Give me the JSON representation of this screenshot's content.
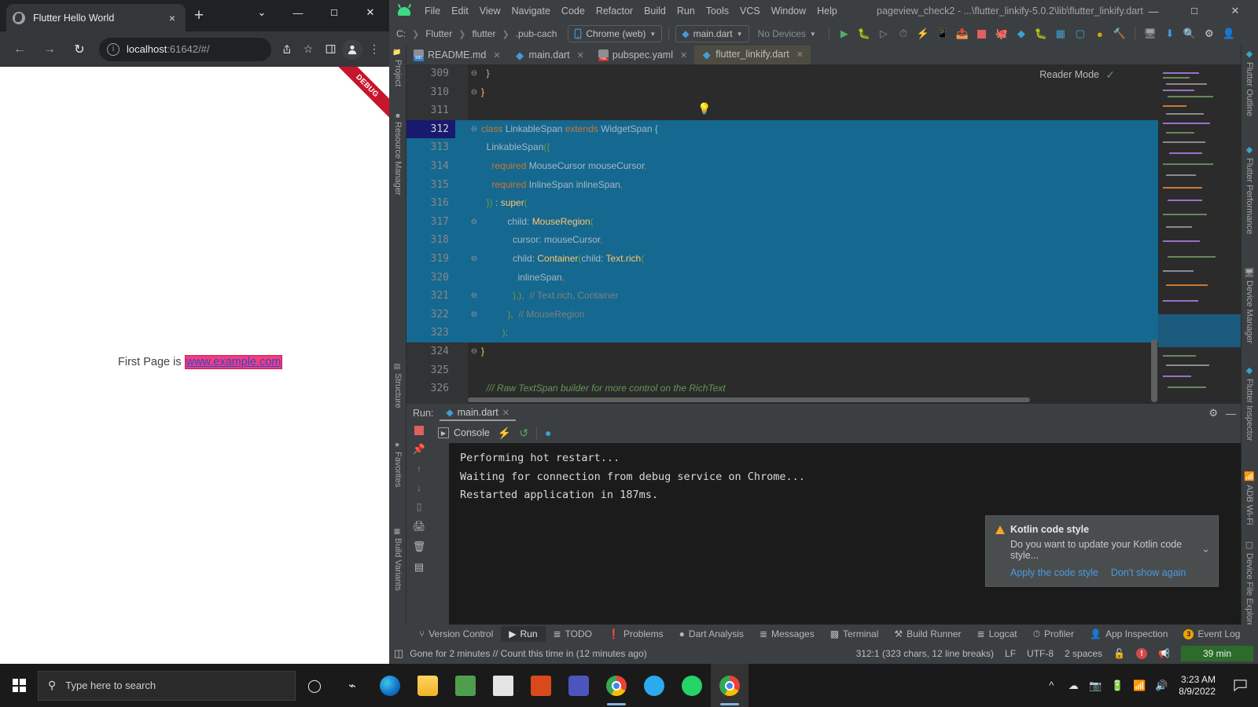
{
  "browser": {
    "tab": {
      "title": "Flutter Hello World",
      "favicon": "globe-icon",
      "close": "×"
    },
    "new_tab": "+",
    "window_controls": {
      "chevron": "⌄",
      "minimize": "—",
      "maximize": "☐",
      "close": "✕"
    },
    "nav": {
      "back": "←",
      "forward": "→",
      "reload": "↻"
    },
    "omnibox": {
      "info_icon": "ⓘ",
      "host": "localhost",
      "rest": ":61642/#/"
    },
    "actions": {
      "share": "share-icon",
      "bookmark": "☆",
      "sidepanel": "▣",
      "profile": "avatar-icon",
      "menu": "⋮"
    },
    "page": {
      "debug_banner": "DEBUG",
      "text_before": "First Page is ",
      "link_text": "www.example.com",
      "link_color": "#1a52d6",
      "link_bg": "#f83b7e"
    }
  },
  "ide": {
    "window_title": "pageview_check2 - ...\\flutter_linkify-5.0.2\\lib\\flutter_linkify.dart",
    "window_controls": {
      "minimize": "—",
      "maximize": "☐",
      "close": "✕"
    },
    "menu": [
      "File",
      "Edit",
      "View",
      "Navigate",
      "Code",
      "Refactor",
      "Build",
      "Run",
      "Tools",
      "VCS",
      "Window",
      "Help"
    ],
    "breadcrumbs": [
      "C:",
      "Flutter",
      "flutter",
      ".pub-cach"
    ],
    "device_selector": "Chrome (web)",
    "run_config": "main.dart",
    "devices_selector": "No Devices",
    "toolbar_icons": [
      "run-icon",
      "debug-icon",
      "run-coverage-icon",
      "profile-icon",
      "hot-reload-icon",
      "device-icon",
      "flutter-attach-icon",
      "stop-icon",
      "dart-devtools-icon",
      "flutter-icon",
      "bug-icon",
      "layout-icon",
      "open-devtools-icon",
      "gradle-icon",
      "clean-icon",
      "device-manager-icon",
      "sdk-manager-icon",
      "search-icon",
      "settings-icon",
      "profile-icon"
    ],
    "left_tool_tabs": [
      "Project",
      "Resource Manager",
      "Structure",
      "Favorites",
      "Build Variants"
    ],
    "right_tool_tabs": [
      "Flutter Outline",
      "Flutter Performance",
      "Device Manager",
      "Flutter Inspector",
      "ADB Wi-Fi",
      "Device File Explorer"
    ],
    "editor_tabs": [
      {
        "label": "README.md",
        "icon": "md-file-icon",
        "active": false
      },
      {
        "label": "main.dart",
        "icon": "dart-file-icon",
        "active": false
      },
      {
        "label": "pubspec.yaml",
        "icon": "yml-file-icon",
        "active": false
      },
      {
        "label": "flutter_linkify.dart",
        "icon": "dart-file-icon",
        "active": true
      }
    ],
    "reader_mode": "Reader Mode",
    "code_lines": [
      {
        "num": "309",
        "fold": "⊖",
        "selected": false,
        "tokens": [
          {
            "t": "  }",
            "c": "p"
          }
        ]
      },
      {
        "num": "310",
        "fold": "⊖",
        "selected": false,
        "tokens": [
          {
            "t": "}",
            "c": "t"
          }
        ]
      },
      {
        "num": "311",
        "fold": "",
        "selected": false,
        "tokens": []
      },
      {
        "num": "312",
        "fold": "⊖",
        "selected": true,
        "current": true,
        "tokens": [
          {
            "t": "class ",
            "c": "k"
          },
          {
            "t": "LinkableSpan ",
            "c": "p"
          },
          {
            "t": "extends ",
            "c": "k"
          },
          {
            "t": "WidgetSpan ",
            "c": "p"
          },
          {
            "t": "{",
            "c": "p"
          }
        ]
      },
      {
        "num": "313",
        "fold": "",
        "selected": true,
        "tokens": [
          {
            "t": "  LinkableSpan",
            "c": "p"
          },
          {
            "t": "({",
            "c": "pa"
          }
        ]
      },
      {
        "num": "314",
        "fold": "",
        "selected": true,
        "tokens": [
          {
            "t": "    required ",
            "c": "k"
          },
          {
            "t": "MouseCursor mouseCursor",
            "c": "p"
          },
          {
            "t": ",",
            "c": "k"
          }
        ]
      },
      {
        "num": "315",
        "fold": "",
        "selected": true,
        "tokens": [
          {
            "t": "    required ",
            "c": "k"
          },
          {
            "t": "InlineSpan inlineSpan",
            "c": "p"
          },
          {
            "t": ",",
            "c": "k"
          }
        ]
      },
      {
        "num": "316",
        "fold": "",
        "selected": true,
        "tokens": [
          {
            "t": "  })",
            "c": "pa"
          },
          {
            "t": " : ",
            "c": "p"
          },
          {
            "t": "super",
            "c": "t"
          },
          {
            "t": "(",
            "c": "pa"
          }
        ]
      },
      {
        "num": "317",
        "fold": "⊖",
        "selected": true,
        "tokens": [
          {
            "t": "          child: ",
            "c": "p"
          },
          {
            "t": "MouseRegion",
            "c": "t"
          },
          {
            "t": "(",
            "c": "pa"
          }
        ]
      },
      {
        "num": "318",
        "fold": "",
        "selected": true,
        "tokens": [
          {
            "t": "            cursor: mouseCursor",
            "c": "p"
          },
          {
            "t": ",",
            "c": "k"
          }
        ]
      },
      {
        "num": "319",
        "fold": "⊖",
        "selected": true,
        "tokens": [
          {
            "t": "            child: ",
            "c": "p"
          },
          {
            "t": "Container",
            "c": "t"
          },
          {
            "t": "(",
            "c": "pa"
          },
          {
            "t": "child: ",
            "c": "p"
          },
          {
            "t": "Text.rich",
            "c": "t"
          },
          {
            "t": "(",
            "c": "pa"
          }
        ]
      },
      {
        "num": "320",
        "fold": "",
        "selected": true,
        "tokens": [
          {
            "t": "              inlineSpan",
            "c": "p"
          },
          {
            "t": ",",
            "c": "k"
          }
        ]
      },
      {
        "num": "321",
        "fold": "⊖",
        "selected": true,
        "tokens": [
          {
            "t": "            )",
            "c": "pa"
          },
          {
            "t": ",",
            "c": "k"
          },
          {
            "t": ")",
            "c": "pa"
          },
          {
            "t": ",",
            "c": "k"
          },
          {
            "t": "  // Text.rich, Container",
            "c": "c"
          }
        ]
      },
      {
        "num": "322",
        "fold": "⊖",
        "selected": true,
        "tokens": [
          {
            "t": "          )",
            "c": "pa"
          },
          {
            "t": ",",
            "c": "k"
          },
          {
            "t": "  // MouseRegion",
            "c": "c"
          }
        ]
      },
      {
        "num": "323",
        "fold": "",
        "selected": true,
        "tokens": [
          {
            "t": "        );",
            "c": "pa"
          }
        ]
      },
      {
        "num": "324",
        "fold": "⊖",
        "selected": false,
        "tokens": [
          {
            "t": "}",
            "c": "t"
          }
        ]
      },
      {
        "num": "325",
        "fold": "",
        "selected": false,
        "tokens": []
      },
      {
        "num": "326",
        "fold": "",
        "selected": false,
        "tokens": [
          {
            "t": "  /// Raw TextSpan builder for more control on the RichText",
            "c": "cdoc"
          }
        ]
      }
    ],
    "run_panel": {
      "label": "Run:",
      "tab": "main.dart",
      "console_tab": "Console",
      "icons": [
        "stop-icon",
        "pin-icon",
        "scroll-up-icon",
        "scroll-down-icon",
        "collapse-icon",
        "print-icon",
        "trash-icon",
        "hot-reload-icon",
        "hot-restart-icon",
        "dart-icon"
      ],
      "output": [
        "Performing hot restart...",
        "Waiting for connection from debug service on Chrome...",
        "Restarted application in 187ms."
      ]
    },
    "notification": {
      "title": "Kotlin code style",
      "body": "Do you want to update your Kotlin code style...",
      "link_primary": "Apply the code style",
      "link_secondary": "Don't show again",
      "collapse_icon": "⌄"
    },
    "bottom_tabs": [
      {
        "label": "Version Control",
        "icon": "branch-icon",
        "active": false
      },
      {
        "label": "Run",
        "icon": "play-icon",
        "active": true
      },
      {
        "label": "TODO",
        "icon": "list-icon",
        "active": false
      },
      {
        "label": "Problems",
        "icon": "warning-icon",
        "active": false
      },
      {
        "label": "Dart Analysis",
        "icon": "dart-icon",
        "active": false
      },
      {
        "label": "Messages",
        "icon": "messages-icon",
        "active": false
      },
      {
        "label": "Terminal",
        "icon": "terminal-icon",
        "active": false
      },
      {
        "label": "Build Runner",
        "icon": "build-icon",
        "active": false
      },
      {
        "label": "Logcat",
        "icon": "logcat-icon",
        "active": false
      },
      {
        "label": "Profiler",
        "icon": "profiler-icon",
        "active": false
      },
      {
        "label": "App Inspection",
        "icon": "inspection-icon",
        "active": false
      },
      {
        "label": "Event Log",
        "icon": "event-log-icon",
        "active": false,
        "badge": "3"
      }
    ],
    "status_bar": {
      "message": "Gone for 2 minutes // Count this time in (12 minutes ago)",
      "caret": "312:1 (323 chars, 12 line breaks)",
      "line_sep": "LF",
      "encoding": "UTF-8",
      "indent": "2 spaces",
      "lock_icon": "unlocked-icon",
      "error_icon": "error-icon",
      "notification_icon": "event-icon",
      "timer": "39 min"
    }
  },
  "taskbar": {
    "start": "windows-logo-icon",
    "search_placeholder": "Type here to search",
    "search_icon": "magnifier-icon",
    "cortana": "cortana-icon",
    "task_view": "task-view-icon",
    "apps": [
      {
        "name": "edge-icon",
        "color": "#29a8e0",
        "running": false
      },
      {
        "name": "file-explorer-icon",
        "color": "#f5c343",
        "running": false
      },
      {
        "name": "store-icon",
        "color": "#4b9b4b",
        "running": false
      },
      {
        "name": "mail-icon",
        "color": "#d9d9d9",
        "running": false
      },
      {
        "name": "office-icon",
        "color": "#d83b01",
        "running": false
      },
      {
        "name": "teams-icon",
        "color": "#5b5fc7",
        "running": false
      },
      {
        "name": "chrome-icon",
        "color": "#4285f4",
        "running": true
      },
      {
        "name": "telegram-icon",
        "color": "#2aabee",
        "running": false
      },
      {
        "name": "whatsapp-icon",
        "color": "#25d366",
        "running": false
      },
      {
        "name": "chrome-debug-icon",
        "color": "#4285f4",
        "running": true
      }
    ],
    "tray": [
      "chevron-up-icon",
      "cloud-icon",
      "screen-record-icon",
      "battery-icon",
      "wifi-icon",
      "volume-icon"
    ],
    "time": "3:23 AM",
    "date": "8/9/2022",
    "action_center": "notification-icon"
  }
}
